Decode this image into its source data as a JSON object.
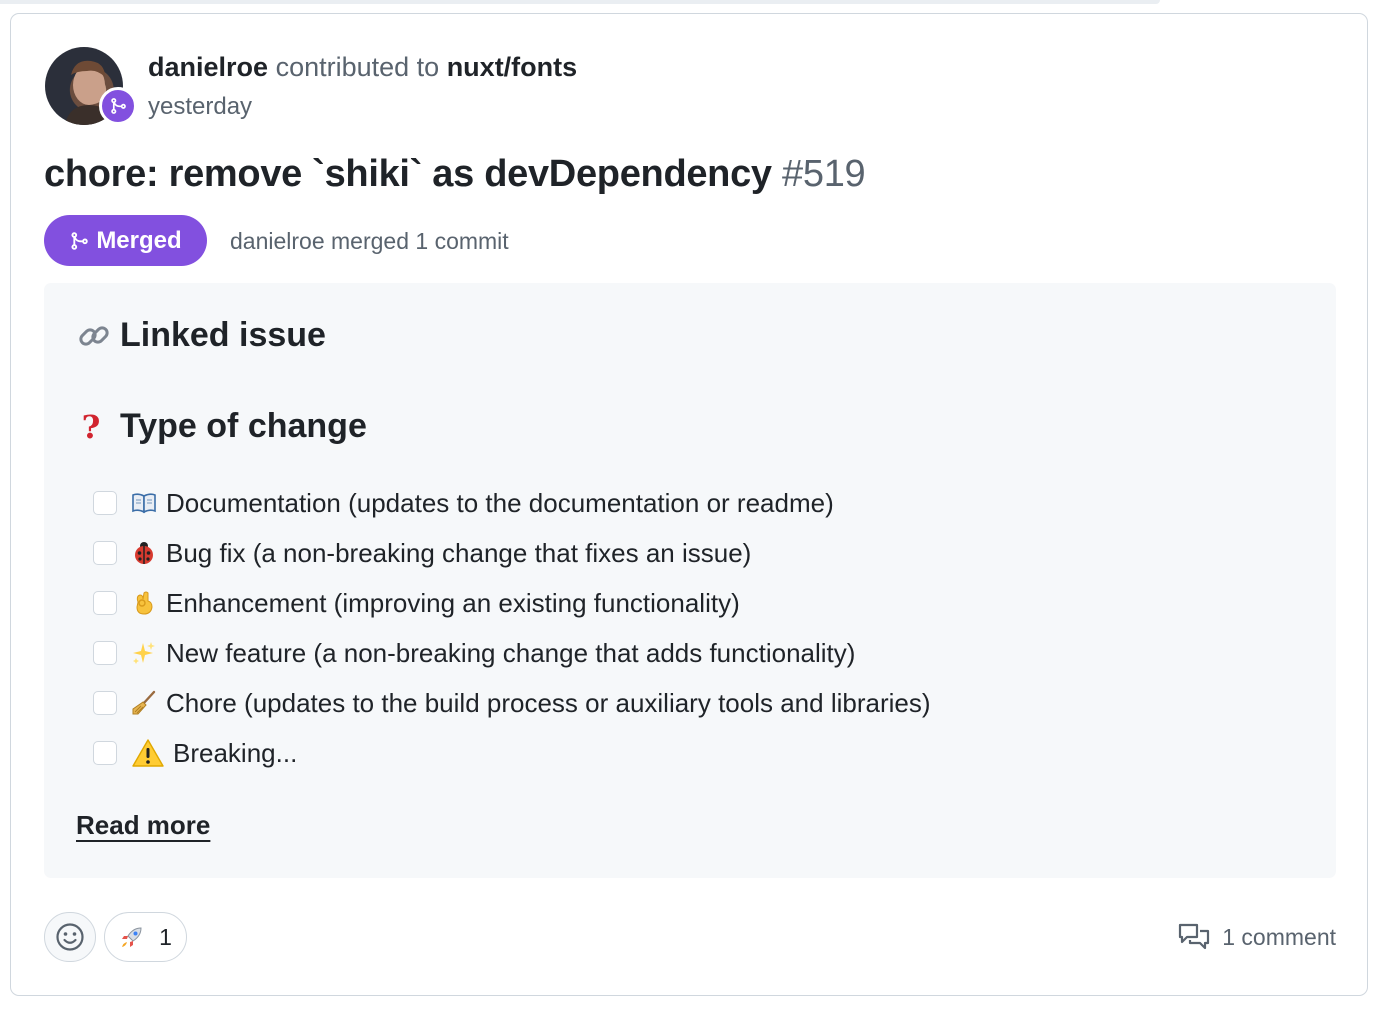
{
  "colors": {
    "merged": "#8250df",
    "muted": "#59636e",
    "text": "#1f2328",
    "border": "#d0d7de",
    "body_bg": "#f6f8fa"
  },
  "event": {
    "actor": "danielroe",
    "verb": "contributed to",
    "repo": "nuxt/fonts",
    "time": "yesterday",
    "avatar_badge_icon": "git-merge-icon"
  },
  "pr": {
    "title": "chore: remove `shiki` as devDependency",
    "number": "#519",
    "state_label": "Merged",
    "state_icon": "git-merge-icon",
    "merge_meta": "danielroe merged 1 commit"
  },
  "body": {
    "linked_heading": "Linked issue",
    "linked_icon": "link-icon",
    "type_heading": "Type of change",
    "type_icon": "question-mark-icon",
    "tasks": [
      {
        "icon": "book-icon",
        "label": "Documentation (updates to the documentation or readme)",
        "checked": false
      },
      {
        "icon": "ladybug-icon",
        "label": "Bug fix (a non-breaking change that fixes an issue)",
        "checked": false
      },
      {
        "icon": "ok-hand-icon",
        "label": "Enhancement (improving an existing functionality)",
        "checked": false
      },
      {
        "icon": "sparkles-icon",
        "label": "New feature (a non-breaking change that adds functionality)",
        "checked": false
      },
      {
        "icon": "broom-icon",
        "label": "Chore (updates to the build process or auxiliary tools and libraries)",
        "checked": false
      },
      {
        "icon": "warning-icon",
        "label": "Breaking...",
        "checked": false
      }
    ],
    "read_more": "Read more"
  },
  "footer": {
    "reaction_picker_icon": "smiley-icon",
    "reactions": [
      {
        "icon": "rocket-icon",
        "count": "1"
      }
    ],
    "comments_icon": "comment-discussion-icon",
    "comments_label": "1 comment"
  }
}
